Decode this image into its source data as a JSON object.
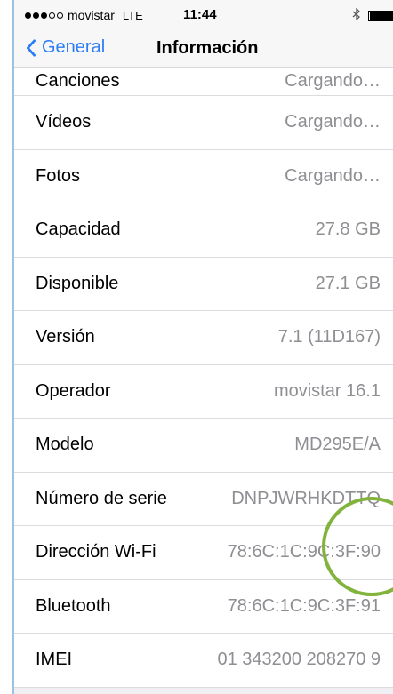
{
  "status_bar": {
    "signal_dots_filled": 3,
    "signal_dots_total": 5,
    "carrier": "movistar",
    "network": "LTE",
    "time": "11:44",
    "bluetooth_icon": "bluetooth-icon",
    "battery_level": 0.85
  },
  "nav": {
    "back_label": "General",
    "title": "Información"
  },
  "rows": [
    {
      "label": "Canciones",
      "value": "Cargando…"
    },
    {
      "label": "Vídeos",
      "value": "Cargando…"
    },
    {
      "label": "Fotos",
      "value": "Cargando…"
    },
    {
      "label": "Capacidad",
      "value": "27.8 GB"
    },
    {
      "label": "Disponible",
      "value": "27.1 GB"
    },
    {
      "label": "Versión",
      "value": "7.1 (11D167)"
    },
    {
      "label": "Operador",
      "value": "movistar 16.1"
    },
    {
      "label": "Modelo",
      "value": "MD295E/A"
    },
    {
      "label": "Número de serie",
      "value": "DNPJWRHKDTTQ"
    },
    {
      "label": "Dirección Wi-Fi",
      "value": "78:6C:1C:9C:3F:90"
    },
    {
      "label": "Bluetooth",
      "value": "78:6C:1C:9C:3F:91"
    },
    {
      "label": "IMEI",
      "value": "01 343200 208270 9"
    }
  ],
  "colors": {
    "accent": "#2c7cf6",
    "annotation": "#82b33c",
    "value_text": "#8e8e93"
  }
}
